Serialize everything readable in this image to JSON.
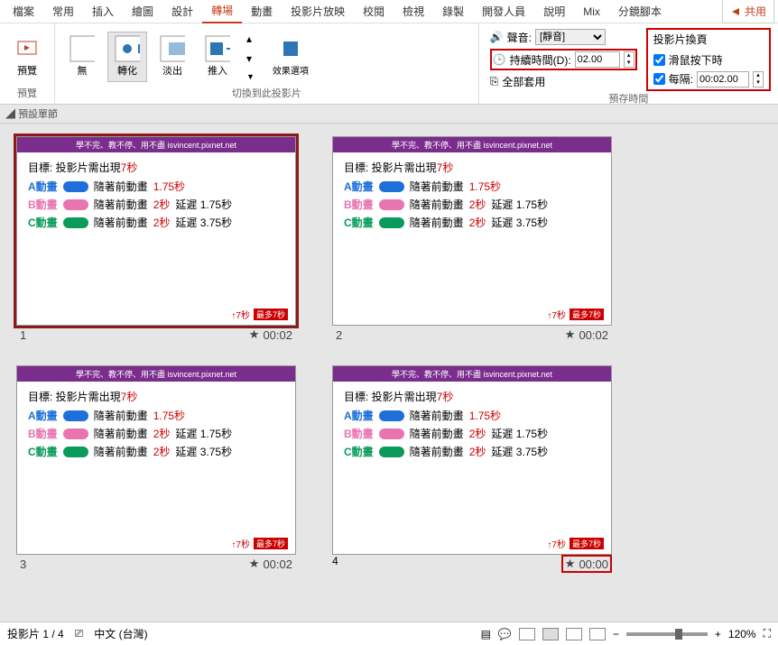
{
  "menu": {
    "tabs": [
      "檔案",
      "常用",
      "插入",
      "繪圖",
      "設計",
      "轉場",
      "動畫",
      "投影片放映",
      "校閱",
      "檢視",
      "錄製",
      "開發人員",
      "說明",
      "Mix",
      "分鏡腳本"
    ],
    "active": 5,
    "share": "共用"
  },
  "ribbon": {
    "preview": {
      "label": "預覽",
      "btn": "預覽"
    },
    "transitions": {
      "label": "切換到此投影片",
      "items": [
        {
          "name": "無"
        },
        {
          "name": "轉化"
        },
        {
          "name": "淡出"
        },
        {
          "name": "推入"
        }
      ],
      "effect_options": "效果選項"
    },
    "timing": {
      "label": "預存時間",
      "sound": "聲音:",
      "sound_value": "[靜音]",
      "duration": "持續時間(D):",
      "duration_value": "02.00",
      "apply_all": "全部套用",
      "advance_title": "投影片換頁",
      "on_click": "滑鼠按下時",
      "after": "每隔:",
      "after_value": "00:02.00"
    }
  },
  "panel_header": "預設單節",
  "slides": [
    {
      "num": "1",
      "time": "00:02",
      "sel": true,
      "hl": false
    },
    {
      "num": "2",
      "time": "00:02",
      "sel": false,
      "hl": false
    },
    {
      "num": "3",
      "time": "00:02",
      "sel": false,
      "hl": false
    },
    {
      "num": "4",
      "time": "00:00",
      "sel": false,
      "hl": true
    }
  ],
  "slide_content": {
    "header": "學不完、教不停、用不盡 isvincent.pixnet.net",
    "goal_pre": "目標: 投影片需出現",
    "goal_sec": "7秒",
    "rows": [
      {
        "label": "A動畫",
        "color": "#1e6fd9",
        "lcolor": "#1e6fd9",
        "t1": "隨著前動畫",
        "t2": "1.75秒",
        "t3": ""
      },
      {
        "label": "B動畫",
        "color": "#e875b0",
        "lcolor": "#e875b0",
        "t1": "隨著前動畫",
        "t2": "2秒",
        "t3": "延遲 1.75秒"
      },
      {
        "label": "C動畫",
        "color": "#0a9b5b",
        "lcolor": "#0a9b5b",
        "t1": "隨著前動畫",
        "t2": "2秒",
        "t3": "延遲 3.75秒"
      }
    ],
    "bot_arrow": "↑7秒",
    "bot_badge": "最多7秒"
  },
  "status": {
    "slide_count": "投影片 1 / 4",
    "lang": "中文 (台灣)",
    "zoom": "120%"
  }
}
